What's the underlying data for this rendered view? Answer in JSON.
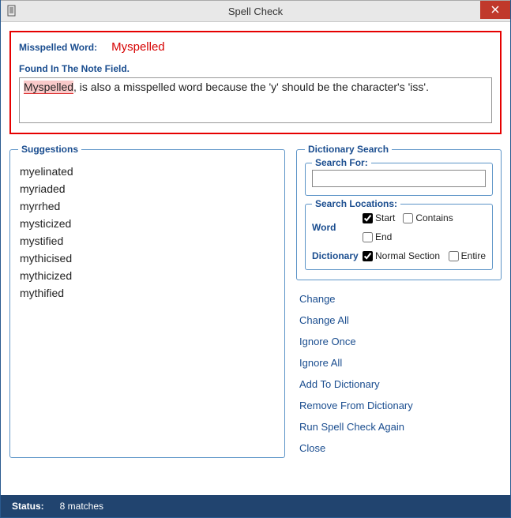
{
  "window": {
    "title": "Spell Check"
  },
  "misspelled": {
    "label": "Misspelled Word:",
    "word": "Myspelled",
    "found_in_label": "Found In The Note Field.",
    "note_prefix": "Myspelled",
    "note_rest": ", is also a misspelled word because the 'y' should be the character's 'iss'."
  },
  "suggestions": {
    "legend": "Suggestions",
    "items": [
      "myelinated",
      "myriaded",
      "myrrhed",
      "mysticized",
      "mystified",
      "mythicised",
      "mythicized",
      "mythified"
    ]
  },
  "dictionary": {
    "legend": "Dictionary Search",
    "search_for_label": "Search For:",
    "search_value": "",
    "locations_label": "Search Locations:",
    "word_label": "Word",
    "dict_label": "Dictionary",
    "opts": {
      "start": "Start",
      "contains": "Contains",
      "end": "End",
      "normal": "Normal Section",
      "entire": "Entire"
    },
    "checked": {
      "start": true,
      "contains": false,
      "end": false,
      "normal": true,
      "entire": false
    }
  },
  "actions": [
    "Change",
    "Change All",
    "Ignore Once",
    "Ignore All",
    "Add To Dictionary",
    "Remove From Dictionary",
    "Run Spell Check Again",
    "Close"
  ],
  "status": {
    "label": "Status:",
    "text": "8 matches"
  }
}
